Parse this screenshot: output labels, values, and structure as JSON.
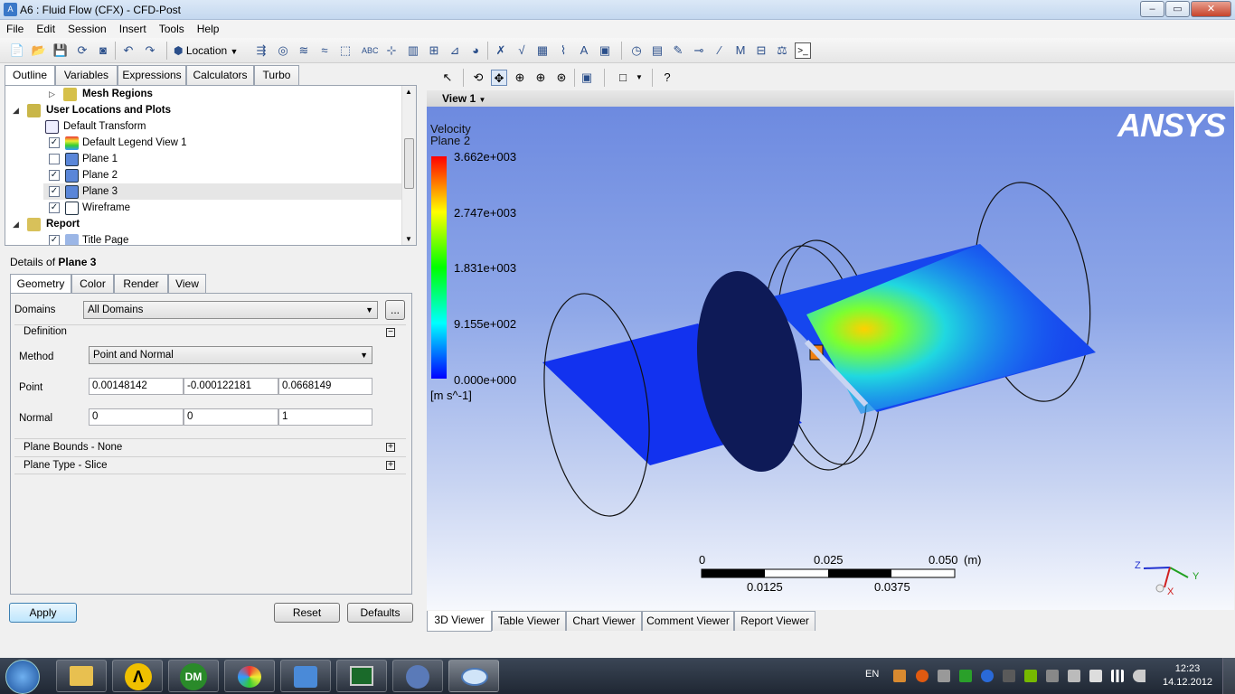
{
  "window": {
    "title": "A6 : Fluid Flow (CFX) - CFD-Post",
    "min": "–",
    "max": "▭",
    "close": "✕"
  },
  "menu": [
    "File",
    "Edit",
    "Session",
    "Insert",
    "Tools",
    "Help"
  ],
  "toolbar": {
    "location_label": "Location"
  },
  "outline_tabs": [
    "Outline",
    "Variables",
    "Expressions",
    "Calculators",
    "Turbo"
  ],
  "tree": {
    "mesh_regions": "Mesh Regions",
    "user_locations": "User Locations and Plots",
    "default_transform": "Default Transform",
    "items": [
      {
        "label": "Default Legend View 1",
        "checked": "✓"
      },
      {
        "label": "Plane 1",
        "checked": ""
      },
      {
        "label": "Plane 2",
        "checked": "✓"
      },
      {
        "label": "Plane 3",
        "checked": "✓"
      },
      {
        "label": "Wireframe",
        "checked": "✓"
      }
    ],
    "report": "Report",
    "title_page": {
      "label": "Title Page",
      "checked": "✓"
    }
  },
  "details": {
    "prefix": "Details of ",
    "object": "Plane 3",
    "tabs": [
      "Geometry",
      "Color",
      "Render",
      "View"
    ],
    "domains_label": "Domains",
    "domains_value": "All Domains",
    "browse": "...",
    "definition": "Definition",
    "method_label": "Method",
    "method_value": "Point and Normal",
    "point_label": "Point",
    "point": [
      "0.00148142",
      "-0.000122181",
      "0.0668149"
    ],
    "normal_label": "Normal",
    "normal": [
      "0",
      "0",
      "1"
    ],
    "plane_bounds": "Plane Bounds - None",
    "plane_type": "Plane Type - Slice",
    "apply": "Apply",
    "reset": "Reset",
    "defaults": "Defaults"
  },
  "viewer": {
    "view_label": "View 1",
    "logo": "ANSYS",
    "legend": {
      "variable": "Velocity",
      "location": "Plane 2",
      "ticks": [
        "3.662e+003",
        "2.747e+003",
        "1.831e+003",
        "9.155e+002",
        "0.000e+000"
      ],
      "unit": "[m s^-1]"
    },
    "scale": {
      "top": [
        "0",
        "0.025",
        "0.050"
      ],
      "unit": "(m)",
      "bottom": [
        "0.0125",
        "0.0375"
      ]
    },
    "axes": {
      "z": "Z",
      "y": "Y",
      "x": "X"
    }
  },
  "viewer_tabs": [
    "3D Viewer",
    "Table Viewer",
    "Chart Viewer",
    "Comment Viewer",
    "Report Viewer"
  ],
  "taskbar": {
    "lang": "EN",
    "time": "12:23",
    "date": "14.12.2012"
  }
}
